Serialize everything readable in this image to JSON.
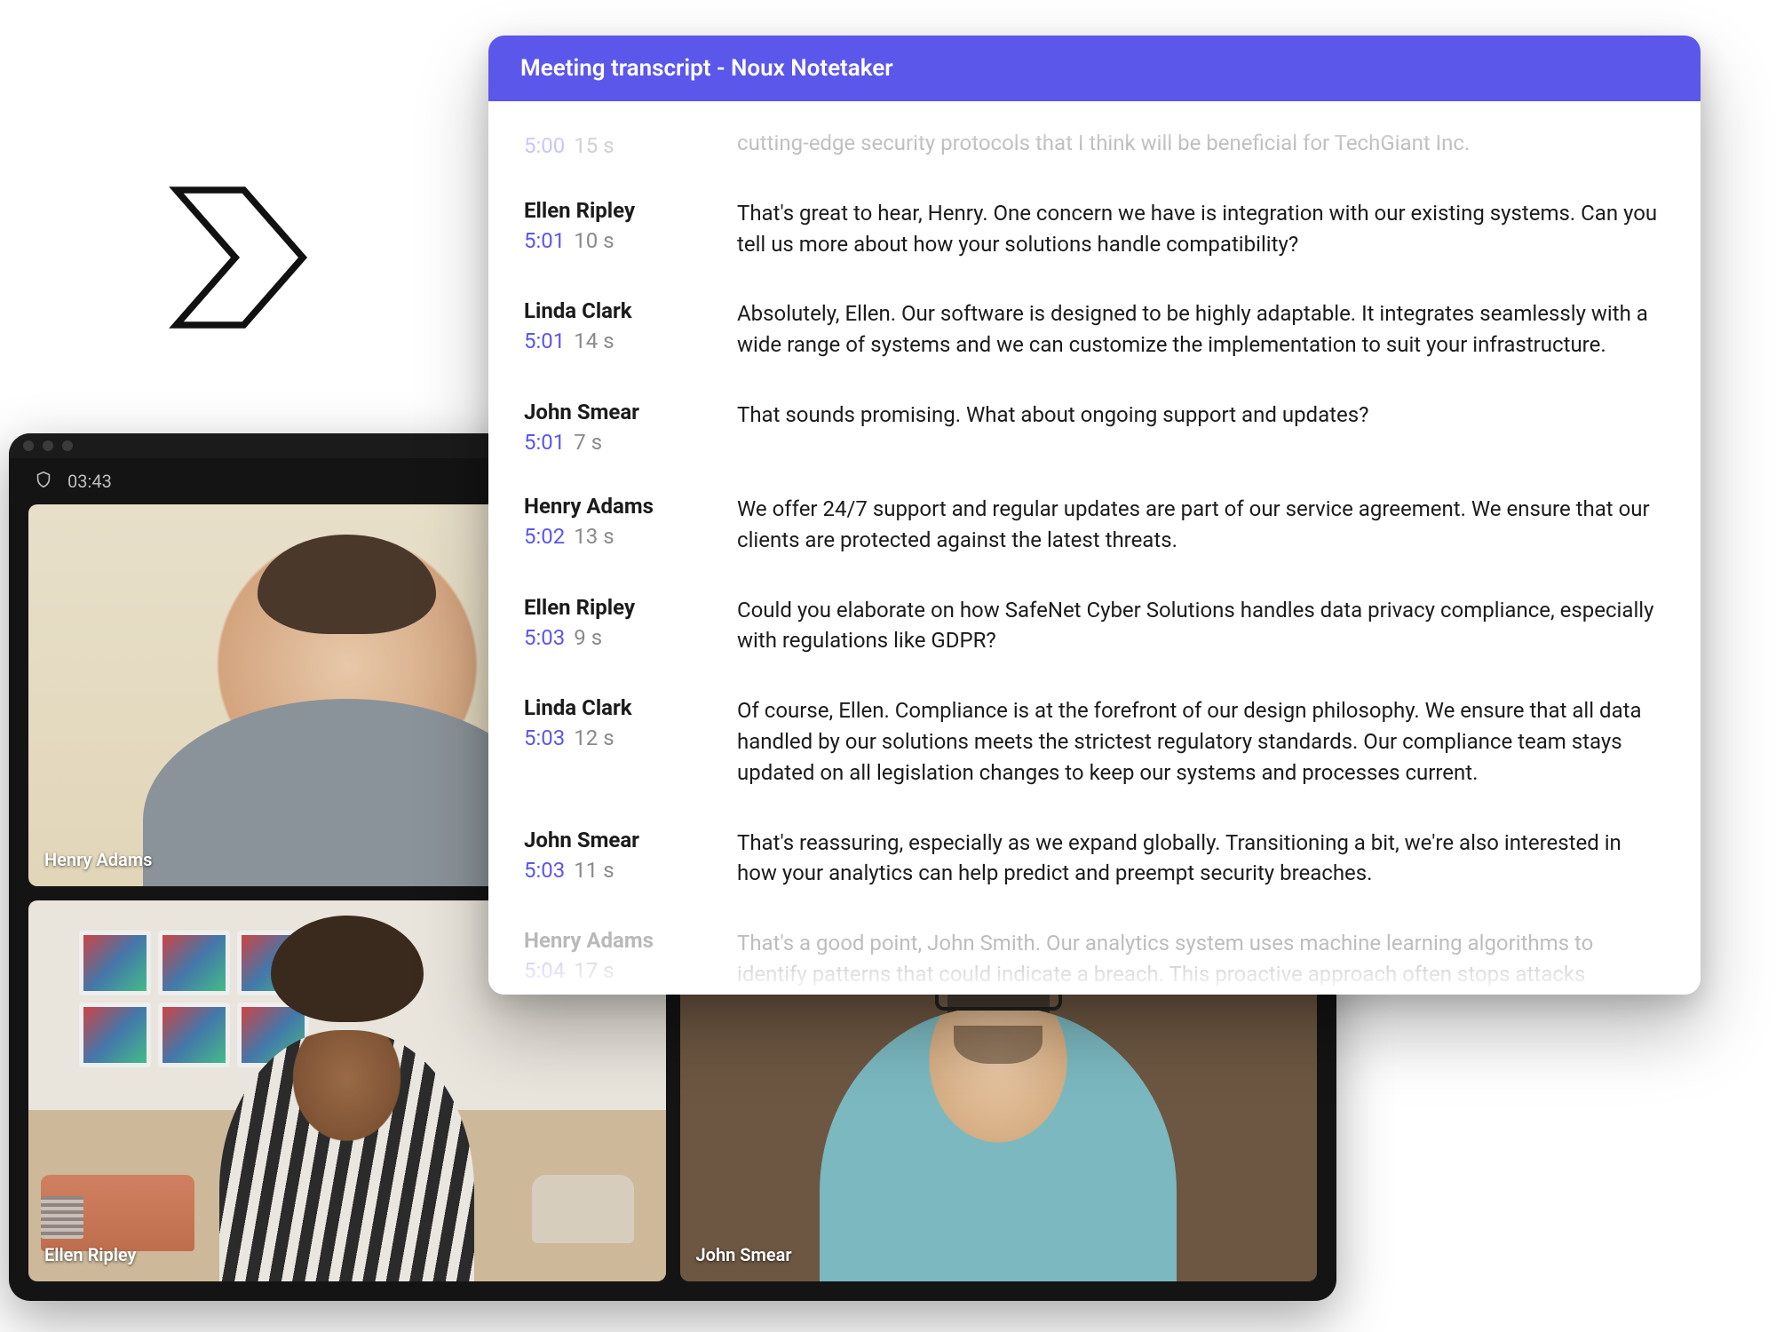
{
  "arrow": {
    "name": "chevron-right-icon"
  },
  "video_window": {
    "timer": "03:43",
    "tiles": [
      {
        "name": "Henry Adams"
      },
      {
        "name": ""
      },
      {
        "name": "Ellen Ripley"
      },
      {
        "name": "John Smear"
      }
    ]
  },
  "transcript": {
    "title": "Meeting transcript - Noux Notetaker",
    "entries": [
      {
        "speaker": "",
        "time": "5:00",
        "duration": "15 s",
        "text": "cutting-edge security protocols that I think will be beneficial for TechGiant Inc.",
        "faded": true
      },
      {
        "speaker": "Ellen Ripley",
        "time": "5:01",
        "duration": "10 s",
        "text": "That's great to hear, Henry. One concern we have is integration with our existing systems. Can you tell us more about how your solutions handle compatibility?"
      },
      {
        "speaker": "Linda Clark",
        "time": "5:01",
        "duration": "14 s",
        "text": "Absolutely, Ellen. Our software is designed to be highly adaptable. It integrates seamlessly with a wide range of systems and we can customize the implementation to suit your infrastructure."
      },
      {
        "speaker": "John Smear",
        "time": "5:01",
        "duration": "7 s",
        "text": "That sounds promising. What about ongoing support and updates?"
      },
      {
        "speaker": "Henry Adams",
        "time": "5:02",
        "duration": "13 s",
        "text": "We offer 24/7 support and regular updates are part of our service agreement. We ensure that our clients are protected against the latest threats."
      },
      {
        "speaker": "Ellen Ripley",
        "time": "5:03",
        "duration": "9 s",
        "text": "Could you elaborate on how SafeNet Cyber Solutions handles data privacy compliance, especially with regulations like GDPR?"
      },
      {
        "speaker": "Linda Clark",
        "time": "5:03",
        "duration": "12 s",
        "text": "Of course, Ellen. Compliance is at the forefront of our design philosophy. We ensure that all data handled by our solutions meets the strictest regulatory standards. Our compliance team stays updated on all legislation changes to keep our systems and processes current."
      },
      {
        "speaker": "John Smear",
        "time": "5:03",
        "duration": "11 s",
        "text": "That's reassuring, especially as we expand globally. Transitioning a bit, we're also interested in how your analytics can help predict and preempt security breaches."
      },
      {
        "speaker": "Henry Adams",
        "time": "5:04",
        "duration": "17 s",
        "text": "That's a good point, John Smith. Our analytics system uses machine learning algorithms to identify patterns that could indicate a breach. This proactive approach often stops attacks",
        "faded": true
      }
    ]
  }
}
